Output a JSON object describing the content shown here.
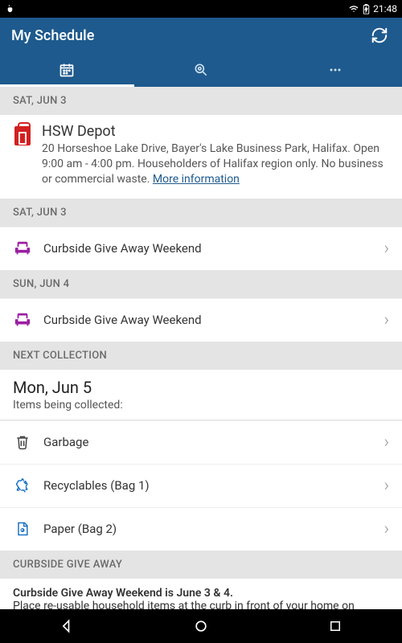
{
  "status": {
    "time": "21:48"
  },
  "header": {
    "title": "My Schedule"
  },
  "sections": [
    {
      "header": "SAT, JUN 3",
      "depot": {
        "title": "HSW Depot",
        "desc": "20 Horseshoe Lake Drive, Bayer's Lake Business Park, Halifax. Open 9:00 am - 4:00 pm. Householders of Halifax region only. No business or commercial waste. ",
        "link_text": "More information"
      }
    },
    {
      "header": "SAT, JUN 3",
      "rows": [
        {
          "label": "Curbside Give Away Weekend",
          "icon": "chair"
        }
      ]
    },
    {
      "header": "SUN, JUN 4",
      "rows": [
        {
          "label": "Curbside Give Away Weekend",
          "icon": "chair"
        }
      ]
    },
    {
      "header": "NEXT COLLECTION",
      "next": {
        "date": "Mon, Jun 5",
        "sub": "Items being collected:"
      },
      "rows": [
        {
          "label": "Garbage",
          "icon": "trash"
        },
        {
          "label": "Recyclables (Bag 1)",
          "icon": "recycle"
        },
        {
          "label": "Paper (Bag 2)",
          "icon": "paper"
        }
      ]
    },
    {
      "header": "CURBSIDE GIVE AWAY",
      "curbside": {
        "bold": "Curbside Give Away Weekend is June 3 & 4.",
        "body": "Place re-usable household items at the curb in front of your home on"
      }
    }
  ]
}
